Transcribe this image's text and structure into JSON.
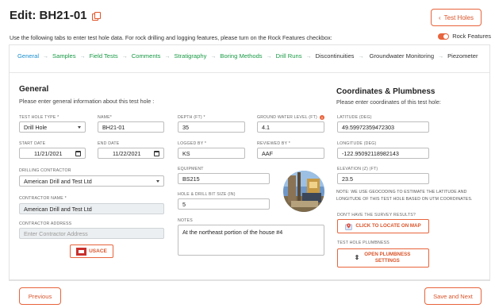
{
  "header": {
    "title": "Edit: BH21-01",
    "back_button": "Test Holes"
  },
  "intro": "Use the following tabs to enter test hole data. For rock drilling and logging features, please turn on the Rock Features checkbox:",
  "rock_features": {
    "label": "Rock Features",
    "on": true
  },
  "tabs": [
    {
      "label": "General",
      "state": "active"
    },
    {
      "label": "Samples",
      "state": "done"
    },
    {
      "label": "Field Tests",
      "state": "done"
    },
    {
      "label": "Comments",
      "state": "done"
    },
    {
      "label": "Stratigraphy",
      "state": "done"
    },
    {
      "label": "Boring Methods",
      "state": "done"
    },
    {
      "label": "Drill Runs",
      "state": "done"
    },
    {
      "label": "Discontinuities",
      "state": "todo"
    },
    {
      "label": "Groundwater Monitoring",
      "state": "todo"
    },
    {
      "label": "Piezometer",
      "state": "todo"
    }
  ],
  "general": {
    "title": "General",
    "subtitle": "Please enter general information about this test hole :",
    "test_hole_type": {
      "label": "TEST HOLE TYPE *",
      "value": "Drill Hole"
    },
    "name": {
      "label": "NAME*",
      "value": "BH21-01"
    },
    "start_date": {
      "label": "START DATE",
      "value": "11/21/2021"
    },
    "end_date": {
      "label": "END DATE",
      "value": "11/22/2021"
    },
    "drilling_contractor": {
      "label": "DRILLING CONTRACTOR",
      "value": "American Drill and Test Ltd"
    },
    "contractor_name": {
      "label": "CONTRACTOR NAME *",
      "value": "American Drill and Test Ltd"
    },
    "contractor_address": {
      "label": "CONTRACTOR ADDRESS",
      "placeholder": "Enter Contractor Address"
    },
    "usace_button": "USACE",
    "depth": {
      "label": "DEPTH (FT) *",
      "value": "35"
    },
    "ground_water_level": {
      "label": "GROUND WATER LEVEL (FT)",
      "value": "4.1"
    },
    "logged_by": {
      "label": "LOGGED BY *",
      "value": "KS"
    },
    "reviewed_by": {
      "label": "REVIEWED BY *",
      "value": "AAF"
    },
    "equipment": {
      "label": "EQUIPMENT",
      "value": "BS215"
    },
    "bit_size": {
      "label": "HOLE & DRILL BIT SIZE (IN)",
      "value": "5"
    },
    "notes": {
      "label": "NOTES",
      "value": "At the northeast portion of the house #4"
    }
  },
  "coordinates": {
    "title": "Coordinates & Plumbness",
    "subtitle": "Please enter coordinates of this test hole:",
    "latitude": {
      "label": "LATITUDE (DEG)",
      "value": "49.59972359472303"
    },
    "longitude": {
      "label": "LONGITUDE (DEG)",
      "value": "-122.95092118982143"
    },
    "elevation": {
      "label": "ELEVATION (Z) (FT)",
      "value": "23.5"
    },
    "note": "NOTE: WE USE GEOCODING TO ESTIMATE THE LATITUDE AND LONGITUDE OF THIS TEST HOLE BASED ON UTM COORDINATES.",
    "survey_prompt": "DON'T HAVE THE SURVEY RESULTS?",
    "locate_button": "CLICK TO LOCATE ON MAP",
    "plumbness_label": "TEST HOLE PLUMBNESS",
    "plumbness_button": "OPEN PLUMBNESS SETTINGS"
  },
  "footer": {
    "previous": "Previous",
    "save_next": "Save and Next"
  },
  "colors": {
    "accent": "#e8643c",
    "tab_done": "#1a9a46",
    "tab_active": "#1a8fcf"
  }
}
